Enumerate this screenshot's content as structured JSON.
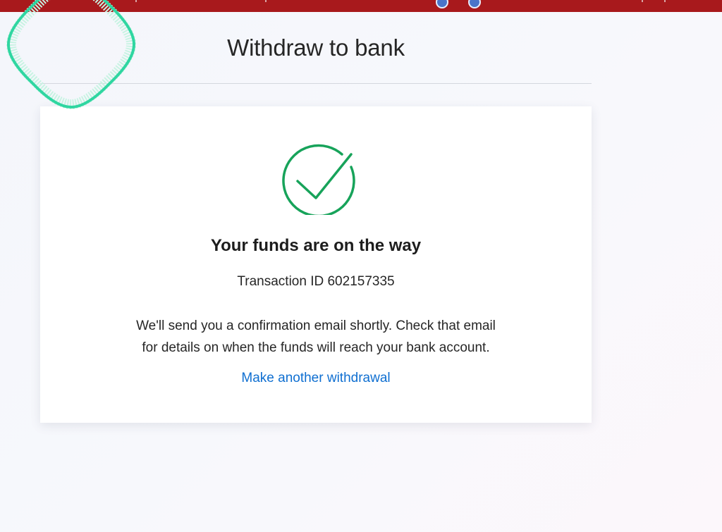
{
  "header": {
    "title": "Withdraw to bank"
  },
  "confirmation": {
    "icon": "checkmark-circle-icon",
    "heading": "Your funds are on the way",
    "transaction_id": "Transaction ID 602157335",
    "message_line_1": "We'll send you a confirmation email shortly. Check that email",
    "message_line_2": "for details on when the funds will reach your bank account.",
    "link_label": "Make another withdrawal"
  },
  "colors": {
    "top_bar": "#a8191c",
    "success_green": "#17a35a",
    "link_blue": "#0f6fd1",
    "focus_ring": "#2fd6a1"
  }
}
